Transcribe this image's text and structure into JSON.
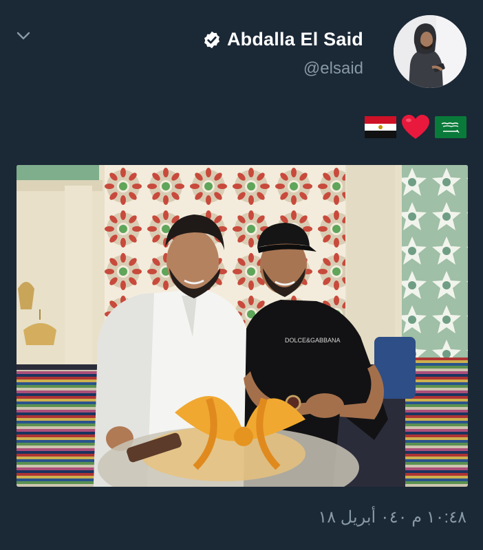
{
  "tweet": {
    "display_name": "Abdalla El Said",
    "handle": "@elsaid",
    "verified": true,
    "avatar_alt": "profile-photo",
    "text_emojis": [
      "egypt-flag",
      "red-heart",
      "saudi-flag"
    ],
    "timestamp": "١٠:٤٨ م ٠٤٠ أبريل ١٨"
  },
  "colors": {
    "background": "#1b2836",
    "text_primary": "#ffffff",
    "text_secondary": "#8899a6"
  },
  "icons": {
    "collapse": "chevron-down-icon",
    "verified": "verified-badge-icon"
  }
}
